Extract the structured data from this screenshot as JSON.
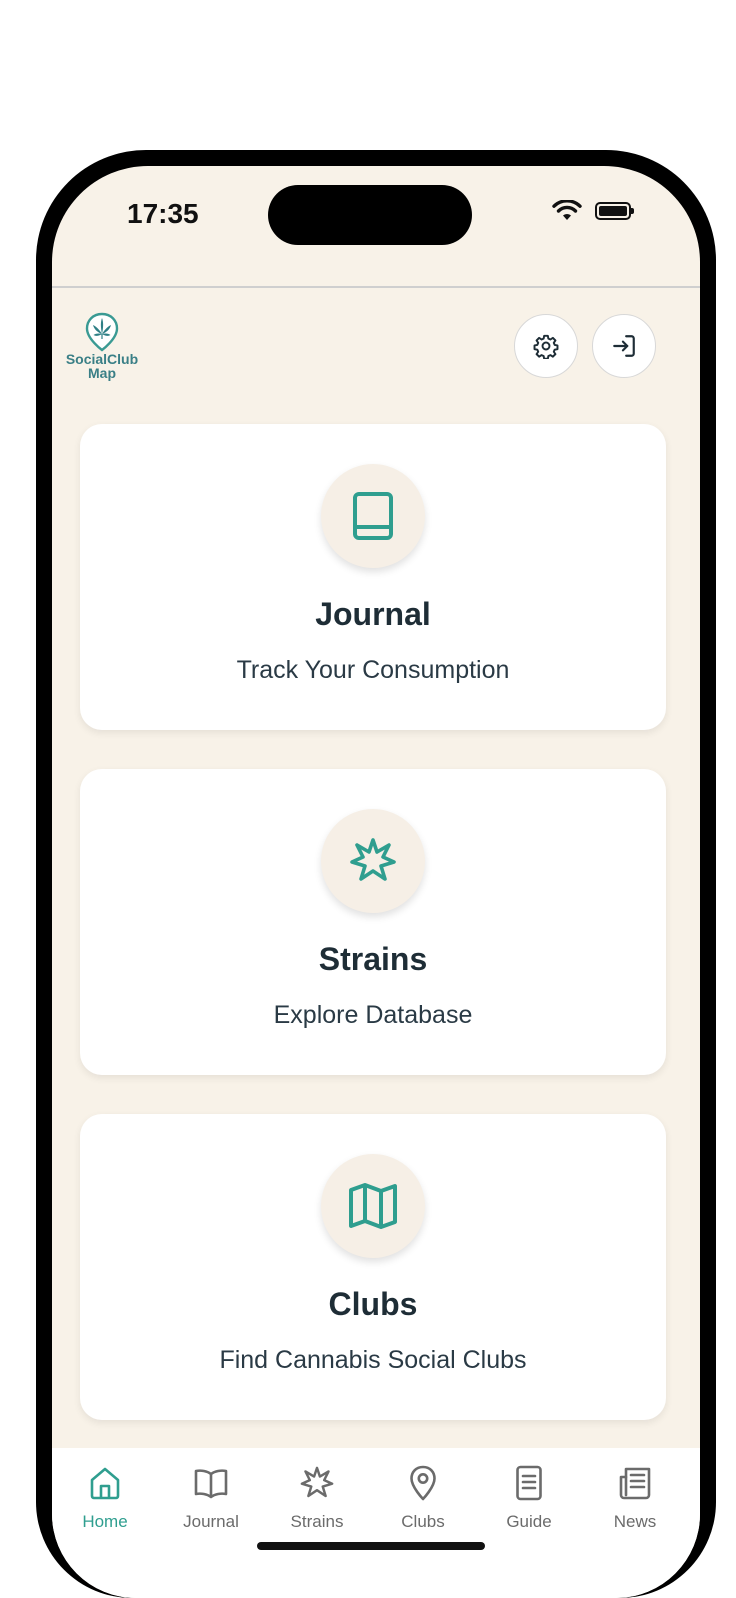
{
  "status": {
    "time": "17:35"
  },
  "logo": {
    "text_line1": "SocialClub",
    "text_line2": "Map"
  },
  "colors": {
    "accent": "#2f9e8f",
    "background": "#f8f2e8",
    "title": "#1e2d36"
  },
  "header": {
    "settings_icon": "gear-icon",
    "login_icon": "login-icon"
  },
  "cards": [
    {
      "title": "Journal",
      "subtitle": "Track Your Consumption",
      "icon": "book-icon"
    },
    {
      "title": "Strains",
      "subtitle": "Explore Database",
      "icon": "cannabis-leaf-icon"
    },
    {
      "title": "Clubs",
      "subtitle": "Find Cannabis Social Clubs",
      "icon": "map-icon"
    }
  ],
  "tabs": [
    {
      "label": "Home",
      "icon": "home-icon",
      "active": true
    },
    {
      "label": "Journal",
      "icon": "open-book-icon",
      "active": false
    },
    {
      "label": "Strains",
      "icon": "cannabis-leaf-icon",
      "active": false
    },
    {
      "label": "Clubs",
      "icon": "map-pin-icon",
      "active": false
    },
    {
      "label": "Guide",
      "icon": "document-icon",
      "active": false
    },
    {
      "label": "News",
      "icon": "newspaper-icon",
      "active": false
    }
  ]
}
